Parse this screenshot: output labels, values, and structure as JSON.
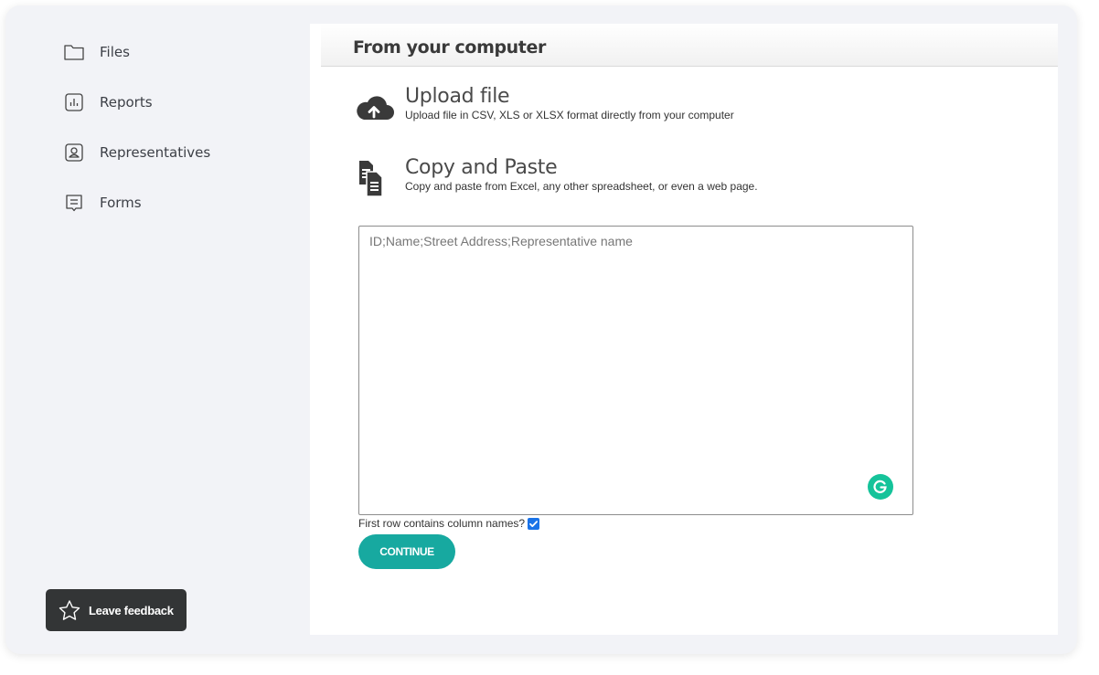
{
  "sidebar": {
    "items": [
      {
        "label": "Files",
        "icon": "folder-icon"
      },
      {
        "label": "Reports",
        "icon": "chart-icon"
      },
      {
        "label": "Representatives",
        "icon": "contact-icon"
      },
      {
        "label": "Forms",
        "icon": "form-icon"
      }
    ],
    "feedback_label": "Leave feedback"
  },
  "main": {
    "title": "From your computer",
    "upload": {
      "title": "Upload file",
      "description": "Upload file in CSV, XLS or XLSX format directly from your computer",
      "icon": "cloud-upload-icon"
    },
    "paste": {
      "title": "Copy and Paste",
      "description": "Copy and paste from Excel, any other spreadsheet, or even a web page.",
      "icon": "copy-paste-icon"
    },
    "textarea": {
      "placeholder": "ID;Name;Street Address;Representative name",
      "value": ""
    },
    "first_row_label": "First row contains column names?",
    "first_row_checked": true,
    "continue_label": "CONTINUE"
  },
  "colors": {
    "accent": "#17a9a0",
    "feedback_bg": "#333536",
    "checkbox": "#1a73e8",
    "grammarly": "#15c39a"
  }
}
